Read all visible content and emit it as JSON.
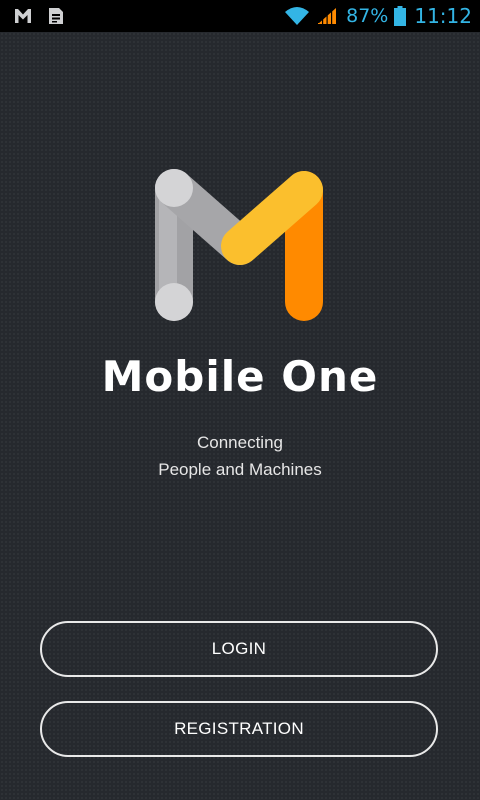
{
  "status_bar": {
    "left_icons": [
      "gmail-icon",
      "sim-card-icon"
    ],
    "battery_percent": "87%",
    "time": "11:12",
    "accent_color": "#33b5e5",
    "signal_color": "#ff8a00"
  },
  "app": {
    "name": "Mobile One",
    "tagline_line1": "Connecting",
    "tagline_line2": "People and Machines",
    "logo_colors": {
      "gray_light": "#d4d4d6",
      "gray_mid": "#a2a2a5",
      "yellow": "#fbbf2d",
      "orange": "#ff8a00"
    },
    "background": "#26292e"
  },
  "buttons": {
    "login_label": "LOGIN",
    "registration_label": "REGISTRATION"
  }
}
